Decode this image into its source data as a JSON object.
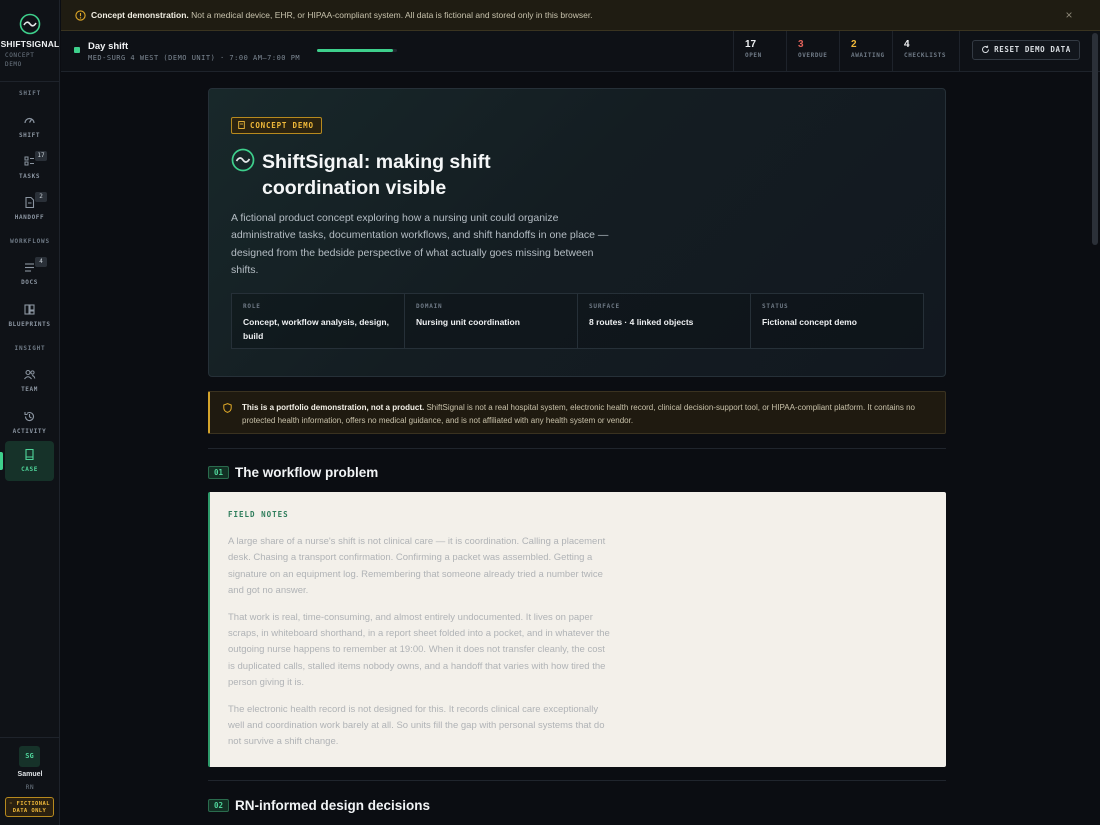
{
  "brand": {
    "name": "SHIFTSIGNAL",
    "sub": "CONCEPT DEMO"
  },
  "sidebar": {
    "sections": [
      {
        "label": "SHIFT"
      },
      {
        "label": "WORKFLOWS"
      },
      {
        "label": "INSIGHT"
      }
    ],
    "items": [
      {
        "label": "SHIFT",
        "icon": "gauge-icon",
        "badge": ""
      },
      {
        "label": "TASKS",
        "icon": "tasks-icon",
        "badge": "17"
      },
      {
        "label": "HANDOFF",
        "icon": "handoff-icon",
        "badge": "2"
      },
      {
        "label": "DOCS",
        "icon": "docs-icon",
        "badge": "4"
      },
      {
        "label": "BLUEPRINTS",
        "icon": "blueprints-icon",
        "badge": ""
      },
      {
        "label": "TEAM",
        "icon": "team-icon",
        "badge": ""
      },
      {
        "label": "ACTIVITY",
        "icon": "history-icon",
        "badge": ""
      },
      {
        "label": "CASE",
        "icon": "case-icon",
        "badge": "",
        "active": true
      }
    ],
    "user": {
      "initials": "SG",
      "name": "Samuel",
      "role": "RN"
    },
    "fictional_badge": "◦ FICTIONAL DATA ONLY"
  },
  "notice": {
    "title": "Concept demonstration.",
    "text": "Not a medical device, EHR, or HIPAA-compliant system. All data is fictional and stored only in this browser.",
    "close": "×"
  },
  "shift": {
    "name": "Day shift",
    "sub": "MED-SURG 4 WEST (DEMO UNIT) · 7:00 AM–7:00 PM",
    "progress": 0.95,
    "stats": [
      {
        "value": "17",
        "label": "OPEN",
        "color": "#eef0f2"
      },
      {
        "value": "3",
        "label": "OVERDUE",
        "color": "#e0625a"
      },
      {
        "value": "2",
        "label": "AWAITING",
        "color": "#f0b93a"
      },
      {
        "value": "4",
        "label": "CHECKLISTS",
        "color": "#eef0f2"
      }
    ],
    "reset_label": "RESET DEMO DATA"
  },
  "hero": {
    "tag": "CONCEPT DEMO",
    "title": "ShiftSignal: making shift coordination visible",
    "description": "A fictional product concept exploring how a nursing unit could organize administrative tasks, documentation workflows, and shift handoffs in one place — designed from the bedside perspective of what actually goes missing between shifts.",
    "meta": [
      {
        "label": "ROLE",
        "value": "Concept, workflow analysis, design, build"
      },
      {
        "label": "DOMAIN",
        "value": "Nursing unit coordination"
      },
      {
        "label": "SURFACE",
        "value": "8 routes · 4 linked objects"
      },
      {
        "label": "STATUS",
        "value": "Fictional concept demo"
      }
    ]
  },
  "disclaimer": {
    "title": "This is a portfolio demonstration, not a product.",
    "text": "ShiftSignal is not a real hospital system, electronic health record, clinical decision-support tool, or HIPAA-compliant platform. It contains no protected health information, offers no medical guidance, and is not affiliated with any health system or vendor."
  },
  "sections": [
    {
      "num": "01",
      "title": "The workflow problem"
    },
    {
      "num": "02",
      "title": "RN-informed design decisions"
    }
  ],
  "field_notes": {
    "label": "FIELD NOTES",
    "paragraphs": [
      "A large share of a nurse's shift is not clinical care — it is coordination. Calling a placement desk. Chasing a transport confirmation. Confirming a packet was assembled. Getting a signature on an equipment log. Remembering that someone already tried a number twice and got no answer.",
      "That work is real, time-consuming, and almost entirely undocumented. It lives on paper scraps, in whiteboard shorthand, in a report sheet folded into a pocket, and in whatever the outgoing nurse happens to remember at 19:00. When it does not transfer cleanly, the cost is duplicated calls, stalled items nobody owns, and a handoff that varies with how tired the person giving it is.",
      "The electronic health record is not designed for this. It records clinical care exceptionally well and coordination work barely at all. So units fill the gap with personal systems that do not survive a shift change."
    ]
  },
  "colors": {
    "accent": "#3ed08c",
    "warning": "#f0b93a",
    "danger": "#e0625a"
  }
}
